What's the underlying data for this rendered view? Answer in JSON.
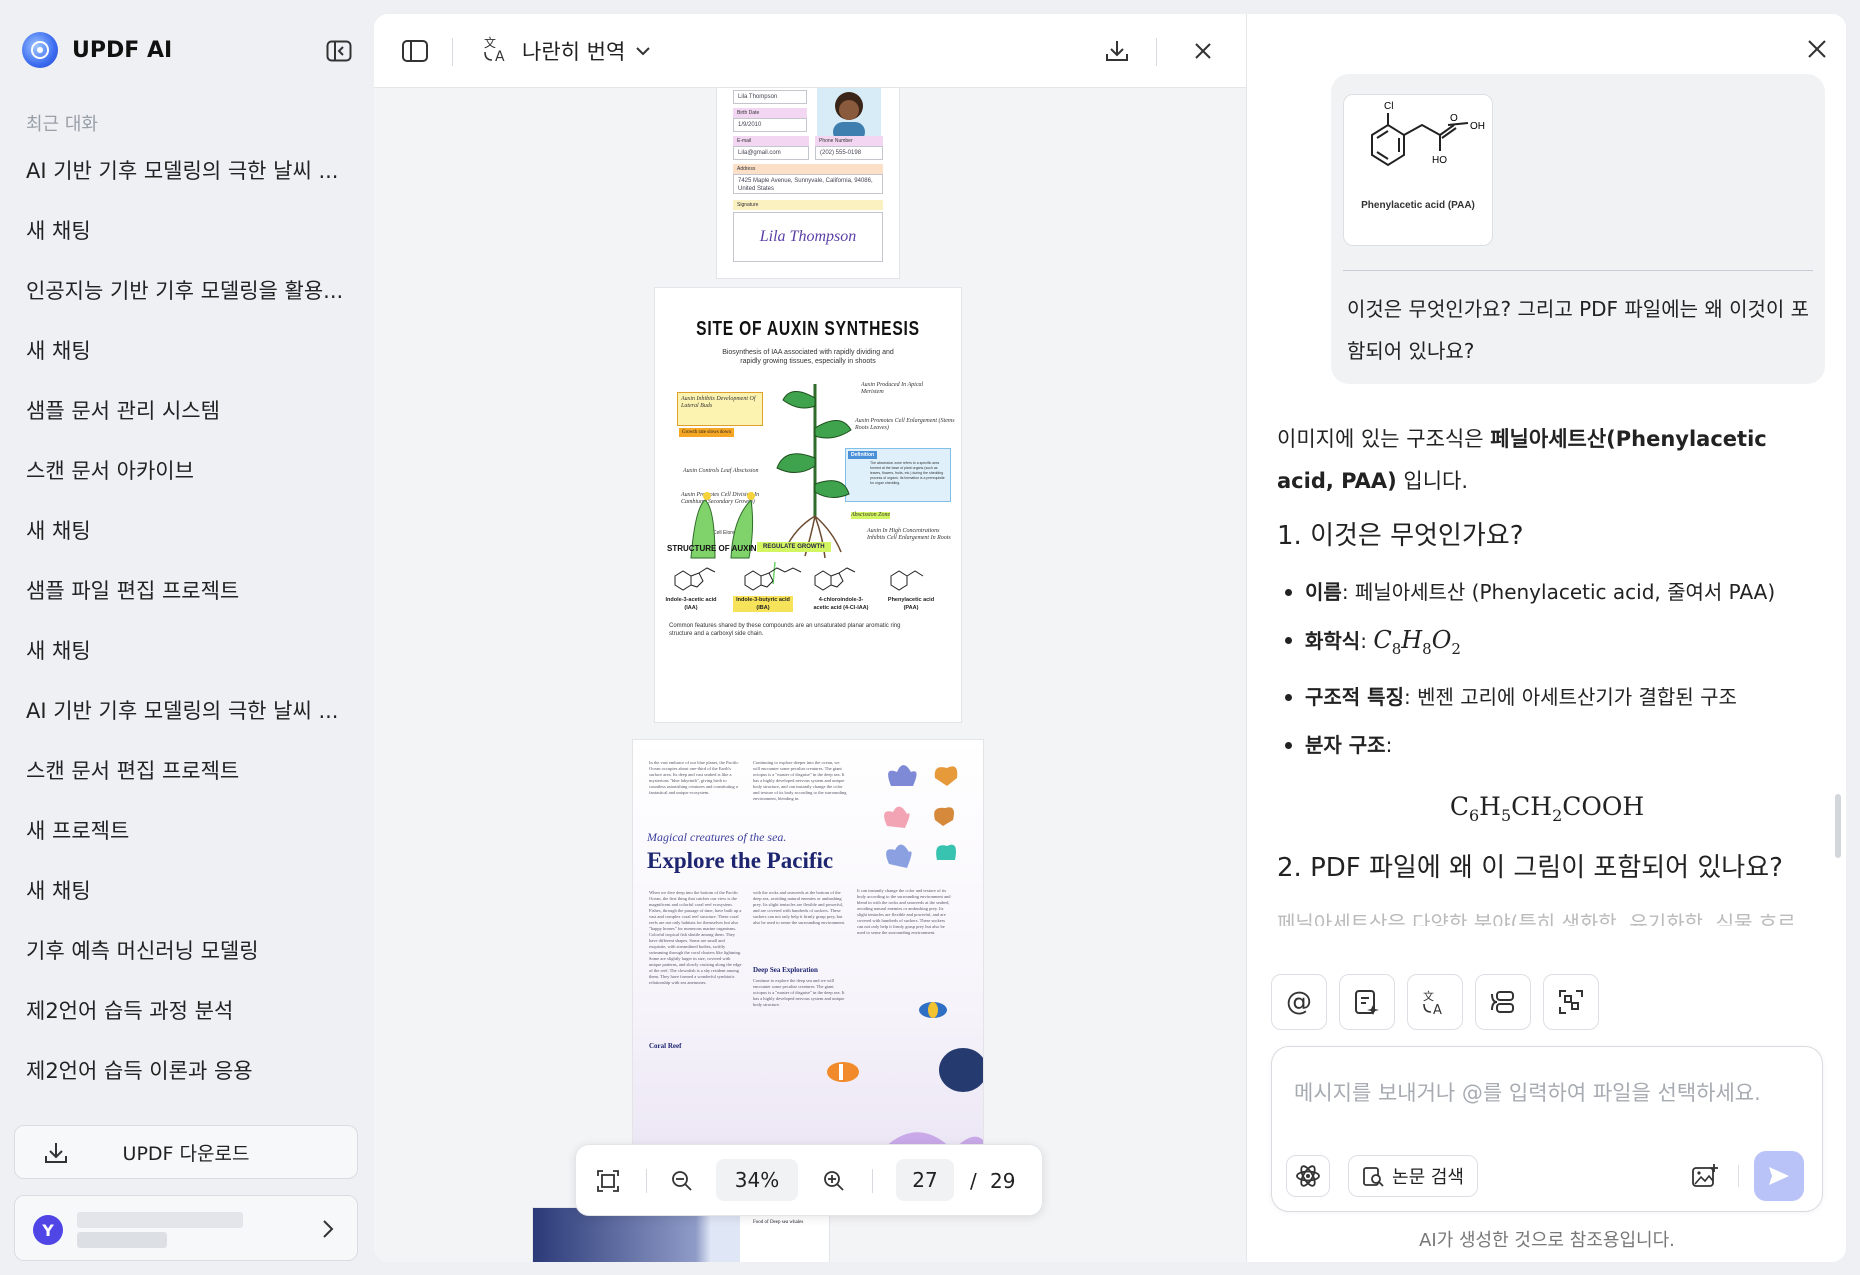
{
  "sidebar": {
    "brand": "UPDF AI",
    "section_label": "최근 대화",
    "chats": [
      "AI 기반 기후 모델링의 극한 날씨 ...",
      "새 채팅",
      "인공지능 기반 기후 모델링을 활용...",
      "새 채팅",
      "샘플 문서 관리 시스템",
      "스캔 문서 아카이브",
      "새 채팅",
      "샘플 파일 편집 프로젝트",
      "새 채팅",
      "AI 기반 기후 모델링의 극한 날씨 ...",
      "스캔 문서 편집 프로젝트",
      "새 프로젝트",
      "새 채팅",
      "기후 예측 머신러닝 모델링",
      "제2언어 습득 과정 분석",
      "제2언어 습득 이론과 응용"
    ],
    "download_label": "UPDF 다운로드",
    "user_initial": "Y"
  },
  "pdf": {
    "translate_mode": "나란히 번역",
    "zoom": "34%",
    "current_page": "27",
    "page_sep": "/",
    "total_pages": "29",
    "form_page": {
      "name_value": "Lila Thompson",
      "birth_label": "Birth Date",
      "birth_value": "1/9/2010",
      "email_label": "E-mail",
      "email_value": "Lila@gmail.com",
      "phone_label": "Phone Number",
      "phone_value": "(202) 555-0198",
      "address_label": "Address",
      "address_value": "7425 Maple Avenue, Sunnyvale, California, 94086, United States",
      "signature_label": "Signature",
      "signature_value": "Lila Thompson"
    },
    "auxin_page": {
      "title": "SITE OF AUXIN SYNTHESIS",
      "subtitle": "Biosynthesis of IAA associated with rapidly dividing and rapidly growing tissues, especially in shoots",
      "note1": "Auxin Inhibits Development Of Lateral Buds",
      "note1b": "Growth rate slows down",
      "note2": "Auxin Produced In Apical Meristem",
      "note3": "Auxin Promotes Cell Enlargement (Stems Roots Leaves)",
      "note4": "Auxin Controls Leaf Abscission",
      "note5": "Definition",
      "note5b": "The abscission zone refers to a specific area formed at the base of plant organs (such as leaves, flowers, fruits, etc.) during the shedding process of organs. Its formation is a prerequisite for organ shedding.",
      "note6": "Auxin Promotes Cell Division In Cambium (Secondary Growth)",
      "note7": "Abscission Zone",
      "note8": "Cell Elongation",
      "note9": "Auxin In High Concentrations Inhibits Cell Enlargement In Roots",
      "structure_heading": "STRUCTURE OF AUXIN",
      "badge": "REGULATE GROWTH",
      "molecules": [
        "Indole-3-acetic acid (IAA)",
        "Indole-3-butyric acid (IBA)",
        "4-chloroindole-3-acetic acid (4-Cl-IAA)",
        "Phenylacetic acid (PAA)"
      ],
      "footer": "Common features shared by these compounds are an unsaturated planar aromatic ring structure and a carboxyl side chain."
    },
    "pacific_page": {
      "para1": "In the vast embrace of our blue planet, the Pacific Ocean occupies about one-third of the Earth's surface area. Its deep and vast seabed is like a mysterious \"blue labyrinth\", giving birth to countless astonishing creatures and constituting a fantastical and unique ecosystem.",
      "para2": "Continuing to explore deeper into the ocean, we will encounter some peculiar creatures. The giant octopus is a \"master of disguise\" in the deep sea. It has a highly developed nervous system and unique body structure, and can instantly change the color and texture of its body according to the surrounding environment, blending in.",
      "magic": "Magical creatures of the sea.",
      "title": "Explore the Pacific",
      "para3": "When we dive deep into the bottom of the Pacific Ocean, the first thing that catches our view is the magnificent and colorful coral reef ecosystem. Fishes, through the passage of time, have built up a vast and complex coral reef structure. These coral reefs are not only habitats for themselves but also \"happy homes\" for numerous marine organisms. Colorful tropical fish shuttle among them. They have different shapes. Some are small and exquisite, with streamlined bodies, swiftly swimming through the coral clusters like lightning. Some are slightly larger in size, covered with unique patterns, and slowly cruising along the edge of the reef. The clownfish is a shy resident among them. They have formed a wonderful symbiotic relationship with sea anemones.",
      "para4": "with the rocks and seaweeds at the bottom of the deep sea, avoiding natural enemies or ambushing prey. Its slight tentacles are flexible and powerful, and are covered with hundreds of suckers. These suckers can not only help it firmly grasp prey, but also be used to sense the surrounding environment.",
      "para5": "It can instantly change the color and texture of its body according to the surrounding environment and blend in with the rocks and seaweeds at the seabed, avoiding natural enemies or ambushing prey. Its slight tentacles are flexible and powerful, and are covered with hundreds of suckers. These suckers can not only help it firmly grasp prey but also be used to sense the surrounding environment.",
      "deep_sea_heading": "Deep Sea Exploration",
      "para6": "Continue to explore the deep sea and we will encounter some peculiar creatures. The giant octopus is a \"master of disguise\" in the deep sea. It has a highly developed nervous system and unique body structure.",
      "coral_heading": "Coral Reef",
      "next_page_snippet": "Food of Deep sea whales"
    }
  },
  "ai": {
    "thumb_label": "Phenylacetic acid (PAA)",
    "thumb_atoms": [
      "Cl",
      "O",
      "OH",
      "HO"
    ],
    "user_question": "이것은 무엇인가요? 그리고 PDF 파일에는 왜 이것이 포함되어 있나요?",
    "intro_prefix": "이미지에 있는 구조식은 ",
    "intro_bold": "페닐아세트산(Phenylacetic acid, PAA)",
    "intro_suffix": " 입니다.",
    "heading1": "1. 이것은 무엇인가요?",
    "items": [
      {
        "label": "이름",
        "text": ": 페닐아세트산 (Phenylacetic acid, 줄여서 PAA)"
      },
      {
        "label": "화학식",
        "text": ": "
      },
      {
        "label": "구조적 특징",
        "text": ": 벤젠 고리에 아세트산기가 결합된 구조"
      },
      {
        "label": "분자 구조",
        "text": ":"
      }
    ],
    "formula_inline": {
      "p1": "C",
      "s1": "8",
      "p2": "H",
      "s2": "8",
      "p3": "O",
      "s3": "2"
    },
    "formula_block": {
      "p1": "C",
      "s1": "6",
      "p2": "H",
      "s2": "5",
      "p3": "CH",
      "s3": "2",
      "p4": "COOH"
    },
    "heading2": "2. PDF 파일에 왜 이 그림이 포함되어 있나요?",
    "faded_text": "페닐아세트산은 다양한 분야(특히 생화학, 유기화학, 식물 호르",
    "placeholder": "메시지를 보내거나 @를 입력하여 파일을 선택하세요.",
    "search_label": "논문 검색",
    "at_symbol": "@",
    "disclaimer": "AI가 생성한 것으로 참조용입니다."
  }
}
